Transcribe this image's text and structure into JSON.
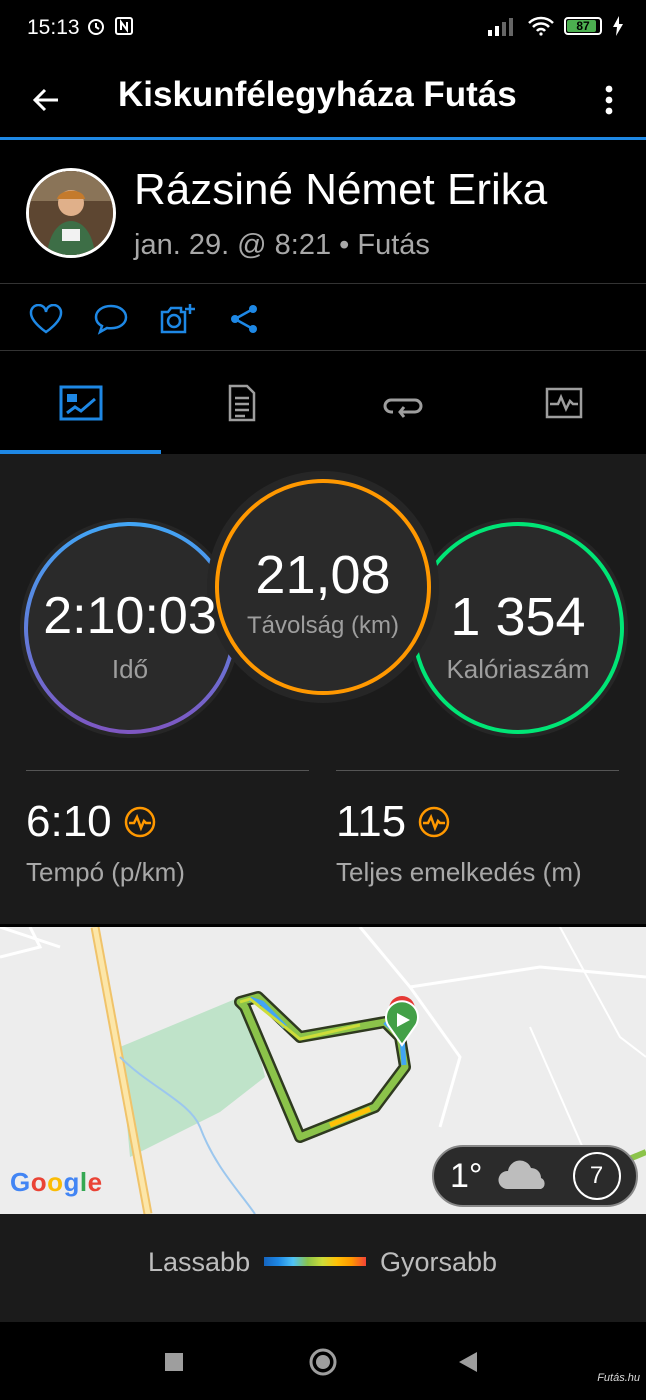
{
  "status_bar": {
    "time": "15:13",
    "battery": "87"
  },
  "app_bar": {
    "title": "Kiskunfélegyháza Futás"
  },
  "profile": {
    "name": "Rázsiné Német Erika",
    "meta": "jan. 29. @ 8:21 • Futás"
  },
  "actions": [
    "heart-icon",
    "comment-icon",
    "add-photo-icon",
    "share-icon"
  ],
  "tabs": [
    "stats-tab",
    "details-tab",
    "laps-tab",
    "charts-tab"
  ],
  "stats": {
    "time": {
      "value": "2:10:03",
      "label": "Idő"
    },
    "distance": {
      "value": "21,08",
      "label": "Távolság (km)"
    },
    "calories": {
      "value": "1 354",
      "label": "Kalóriaszám"
    },
    "pace": {
      "value": "6:10",
      "label": "Tempó (p/km)"
    },
    "elevation": {
      "value": "115",
      "label": "Teljes emelkedés (m)"
    }
  },
  "map": {
    "provider": "Google",
    "weather": {
      "temperature": "1°",
      "wind": "7"
    }
  },
  "legend": {
    "slow": "Lassabb",
    "fast": "Gyorsabb"
  },
  "watermark": "Futás.hu",
  "colors": {
    "accent": "#1e88e5",
    "time_ring_start": "#42a5f5",
    "time_ring_end": "#7e57c2",
    "distance_ring": "#ff9800",
    "calories_ring": "#00e676",
    "pace_icon": "#ff9800"
  }
}
